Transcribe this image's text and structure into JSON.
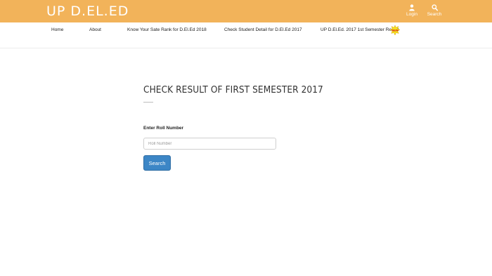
{
  "header": {
    "brand": "UP D.EL.ED",
    "login_label": "Login",
    "search_label": "Search",
    "background_color": "#f2b35a",
    "login_icon": "user-icon",
    "search_icon": "search-icon"
  },
  "nav": {
    "items": [
      {
        "label": "Home"
      },
      {
        "label": "About"
      },
      {
        "label": "Know Your Sate Rank for D.El.Ed 2018"
      },
      {
        "label": "Check Student Detail for D.El.Ed 2017"
      },
      {
        "label": "UP D.El.Ed. 2017 1st Semester Result"
      }
    ],
    "new_badge_label": "NEW",
    "new_badge_icon": "new-starburst-icon"
  },
  "main": {
    "title": "CHECK RESULT OF FIRST SEMESTER 2017",
    "roll_label": "Enter Roll Number",
    "roll_placeholder": "Roll Number",
    "roll_value": "",
    "search_button": "Search",
    "button_color": "#3c86c6"
  }
}
